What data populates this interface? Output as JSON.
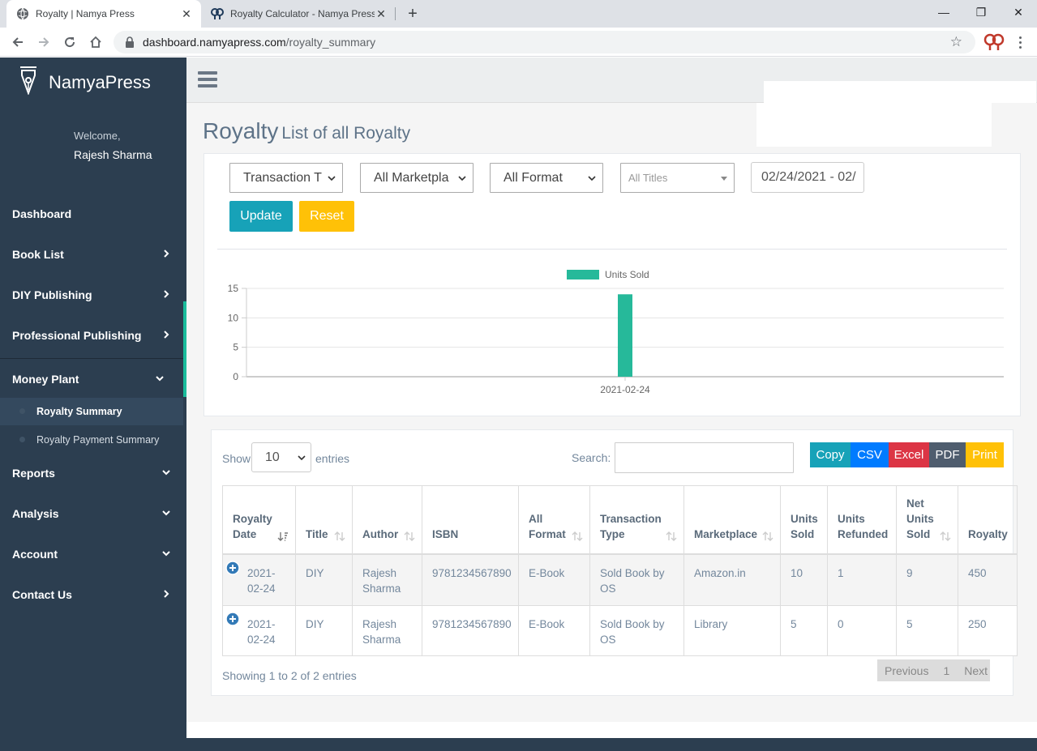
{
  "browser": {
    "tabs": [
      {
        "title": "Royalty | Namya Press",
        "active": true
      },
      {
        "title": "Royalty Calculator - Namya Press",
        "active": false
      }
    ],
    "new_tab": "+",
    "url_host": "dashboard.namyapress.com",
    "url_path": "/royalty_summary",
    "window_controls": {
      "minimize": "—",
      "maximize": "❐",
      "close": "✕"
    }
  },
  "sidebar": {
    "brand": "NamyaPress",
    "welcome": "Welcome,",
    "user": "Rajesh Sharma",
    "items": [
      {
        "label": "Dashboard",
        "chevron": "none"
      },
      {
        "label": "Book List",
        "chevron": "right"
      },
      {
        "label": "DIY Publishing",
        "chevron": "right"
      },
      {
        "label": "Professional Publishing",
        "chevron": "right"
      },
      {
        "label": "Money Plant",
        "chevron": "down"
      },
      {
        "label": "Reports",
        "chevron": "down"
      },
      {
        "label": "Analysis",
        "chevron": "down"
      },
      {
        "label": "Account",
        "chevron": "down"
      },
      {
        "label": "Contact Us",
        "chevron": "right"
      }
    ],
    "subitems": [
      {
        "label": "Royalty Summary",
        "active": true
      },
      {
        "label": "Royalty Payment Summary",
        "active": false
      }
    ],
    "accent": "#1abc9c"
  },
  "page": {
    "title": "Royalty",
    "subtitle": "List of all Royalty"
  },
  "filters": {
    "transaction": "Transaction T",
    "marketplace": "All Marketpla",
    "format": "All Format",
    "titles": "All Titles",
    "date_range": "02/24/2021 - 02/",
    "update": "Update",
    "reset": "Reset"
  },
  "chart_data": {
    "type": "bar",
    "categories": [
      "2021-02-24"
    ],
    "series": [
      {
        "name": "Units Sold",
        "values": [
          14
        ],
        "color": "#26b99a"
      }
    ],
    "ylim": [
      0,
      15
    ],
    "yticks": [
      0,
      5,
      10,
      15
    ],
    "legend": "top",
    "grid": true
  },
  "table_controls": {
    "show": "Show",
    "entries_value": "10",
    "entries": "entries",
    "search": "Search:",
    "exports": [
      {
        "label": "Copy",
        "color": "#17a2b8"
      },
      {
        "label": "CSV",
        "color": "#007bff"
      },
      {
        "label": "Excel",
        "color": "#dc3545"
      },
      {
        "label": "PDF",
        "color": "#4f5d6e"
      },
      {
        "label": "Print",
        "color": "#ffc107"
      }
    ]
  },
  "table": {
    "columns": [
      "Royalty Date",
      "Title",
      "Author",
      "ISBN",
      "All Format",
      "Transaction Type",
      "Marketplace",
      "Units Sold",
      "Units Refunded",
      "Net Units Sold",
      "Royalty"
    ],
    "rows": [
      [
        "2021-02-24",
        "DIY",
        "Rajesh Sharma",
        "9781234567890",
        "E-Book",
        "Sold Book by OS",
        "Amazon.in",
        "10",
        "1",
        "9",
        "450"
      ],
      [
        "2021-02-24",
        "DIY",
        "Rajesh Sharma",
        "9781234567890",
        "E-Book",
        "Sold Book by OS",
        "Library",
        "5",
        "0",
        "5",
        "250"
      ]
    ]
  },
  "pagination": {
    "info": "Showing 1 to 2 of 2 entries",
    "previous": "Previous",
    "page": "1",
    "next": "Next"
  }
}
